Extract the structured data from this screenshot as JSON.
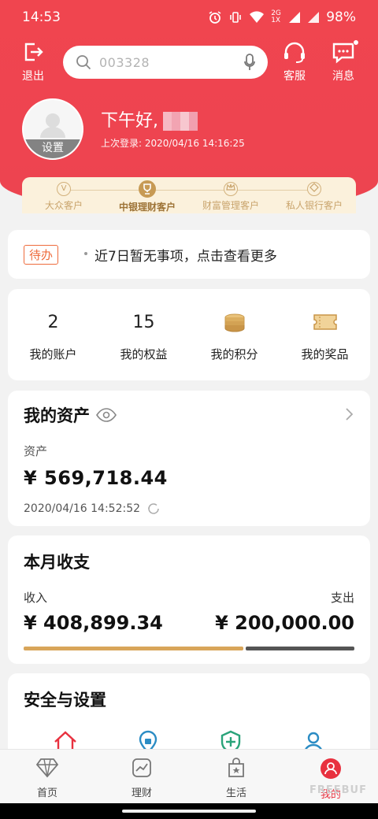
{
  "status_bar": {
    "time": "14:53",
    "network": "2G 1X",
    "battery": "98%"
  },
  "header": {
    "logout_label": "退出",
    "search_placeholder": "003328",
    "service_label": "客服",
    "message_label": "消息"
  },
  "profile": {
    "settings_label": "设置",
    "greeting": "下午好,",
    "last_login": "上次登录: 2020/04/16 14:16:25"
  },
  "tiers": [
    {
      "label": "大众客户",
      "icon": "V"
    },
    {
      "label": "中银理财客户",
      "icon": "trophy"
    },
    {
      "label": "财富管理客户",
      "icon": "crown"
    },
    {
      "label": "私人银行客户",
      "icon": "diamond"
    }
  ],
  "todo": {
    "tag": "待办",
    "text": "近7日暂无事项，点击查看更多"
  },
  "stats": [
    {
      "value": "2",
      "label": "我的账户"
    },
    {
      "value": "15",
      "label": "我的权益"
    },
    {
      "value": "",
      "label": "我的积分"
    },
    {
      "value": "",
      "label": "我的奖品"
    }
  ],
  "assets": {
    "title": "我的资产",
    "sub_label": "资产",
    "amount": "¥ 569,718.44",
    "timestamp": "2020/04/16 14:52:52"
  },
  "monthly": {
    "title": "本月收支",
    "income_label": "收入",
    "expense_label": "支出",
    "income_amount": "¥ 408,899.34",
    "expense_amount": "¥ 200,000.00",
    "income_ratio": 0.67
  },
  "security": {
    "title": "安全与设置"
  },
  "tabs": [
    {
      "label": "首页",
      "icon": "diamond-icon"
    },
    {
      "label": "理财",
      "icon": "chart-icon"
    },
    {
      "label": "生活",
      "icon": "bag-icon"
    },
    {
      "label": "我的",
      "icon": "user-icon"
    }
  ],
  "watermark": "FREEBUF",
  "colors": {
    "brand_red": "#ee4450",
    "gold": "#d8a55a",
    "tier_bg": "#fbf1dc"
  }
}
